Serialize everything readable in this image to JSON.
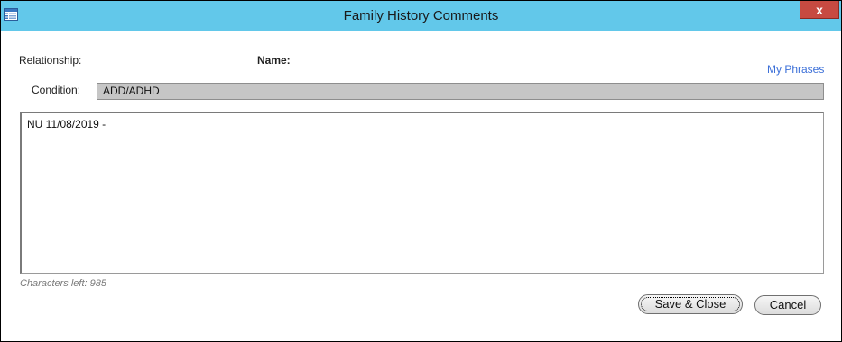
{
  "window": {
    "title": "Family History Comments",
    "title_bar_color": "#62c8ea",
    "close_label": "x",
    "close_color": "#c74a41",
    "app_icon": "window-list-icon"
  },
  "form": {
    "relationship_label": "Relationship:",
    "name_label": "Name:",
    "my_phrases_link": "My Phrases",
    "condition_label": "Condition:",
    "condition_value": "ADD/ADHD",
    "comment_text": "NU 11/08/2019 -",
    "characters_left": "Characters left: 985"
  },
  "buttons": {
    "save_close": "Save & Close",
    "cancel": "Cancel"
  },
  "colors": {
    "link": "#3b6fd8",
    "field_disabled_bg": "#c6c6c6"
  }
}
